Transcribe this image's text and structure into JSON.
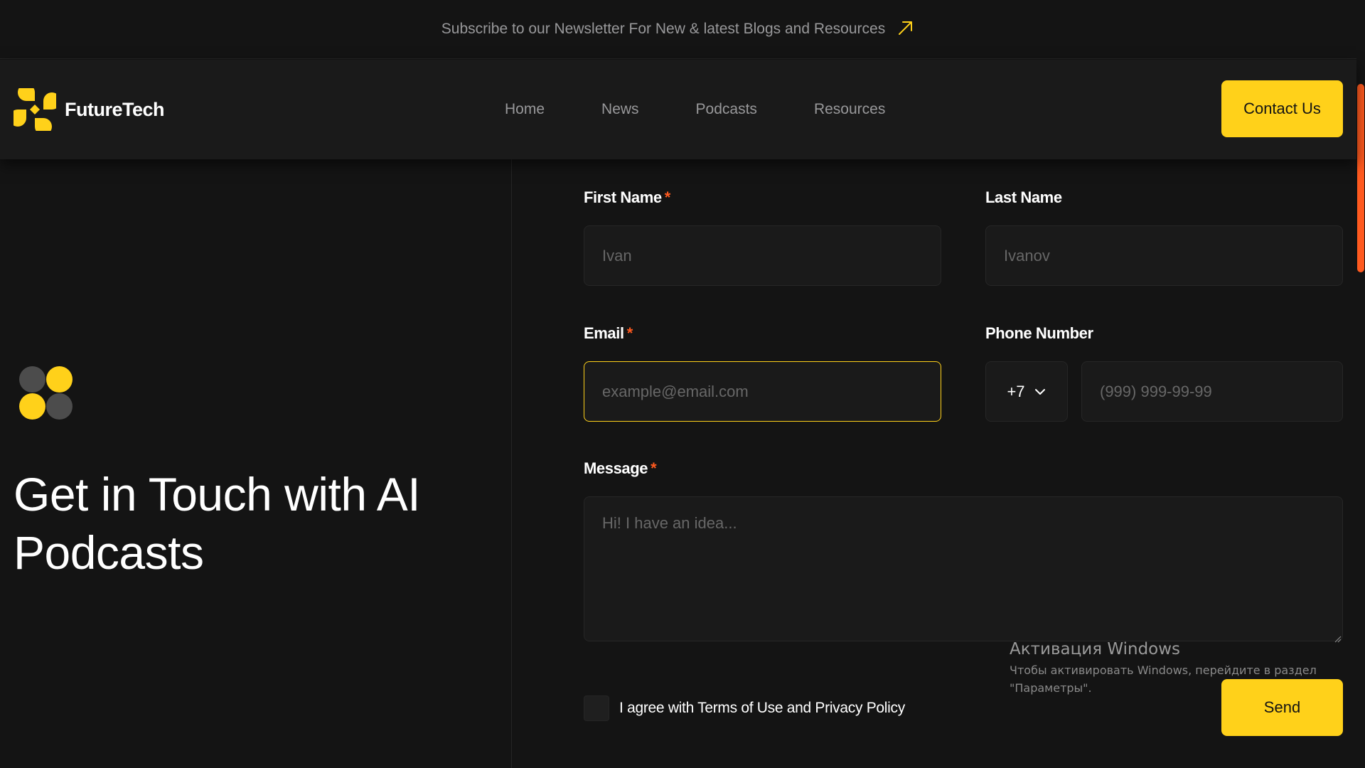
{
  "banner": {
    "text": "Subscribe to our Newsletter For New & latest Blogs and Resources",
    "icon": "arrow-up-right-icon"
  },
  "header": {
    "brand": "FutureTech",
    "nav": [
      "Home",
      "News",
      "Podcasts",
      "Resources"
    ],
    "contact_label": "Contact Us"
  },
  "hero": {
    "title": "Get in Touch with AI Podcasts"
  },
  "form": {
    "first_name": {
      "label": "First Name",
      "required": "*",
      "placeholder": "Ivan"
    },
    "last_name": {
      "label": "Last Name",
      "placeholder": "Ivanov"
    },
    "email": {
      "label": "Email",
      "required": "*",
      "placeholder": "example@email.com"
    },
    "phone": {
      "label": "Phone Number",
      "country_code": "+7",
      "placeholder": "(999) 999-99-99"
    },
    "message": {
      "label": "Message",
      "required": "*",
      "placeholder": "Hi! I have an idea..."
    },
    "agree_label": "I agree with Terms of Use and Privacy Policy",
    "send_label": "Send"
  },
  "watermark": {
    "title": "Активация Windows",
    "line1": "Чтобы активировать Windows, перейдите в раздел",
    "line2": "\"Параметры\"."
  },
  "colors": {
    "accent": "#ffd11a",
    "required": "#ff5a1f",
    "background": "#141414",
    "surface": "#1a1a1a",
    "muted_text": "#98989a",
    "dot_dark": "#4c4c4c"
  }
}
